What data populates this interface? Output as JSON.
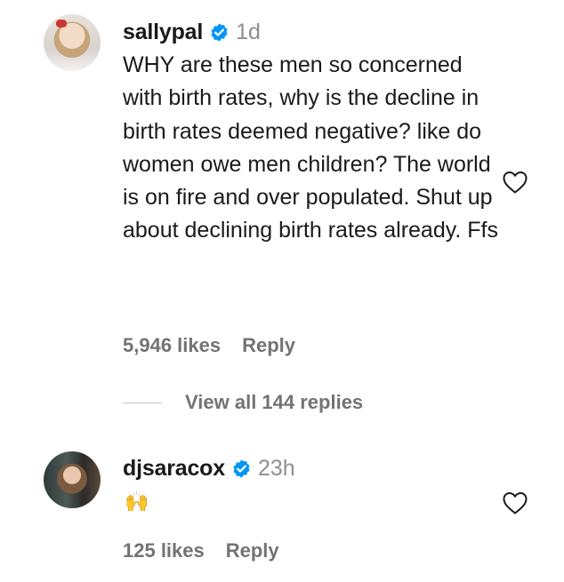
{
  "comments": [
    {
      "username": "sallypal",
      "time": "1d",
      "text": "WHY are these men so concerned with birth rates, why is the decline in birth rates deemed negative? like do women owe men children? The world is on fire and over populated. Shut up about declining birth rates already. Ffs",
      "likes": "5,946 likes",
      "reply": "Reply"
    },
    {
      "username": "djsaracox",
      "time": "23h",
      "text": "🙌",
      "likes": "125 likes",
      "reply": "Reply"
    }
  ],
  "view_replies": "View all 144 replies",
  "colors": {
    "verified": "#0095f6",
    "muted": "#737373",
    "text": "#1a1a1a"
  },
  "icons": [
    "verified-badge-icon",
    "heart-icon"
  ]
}
